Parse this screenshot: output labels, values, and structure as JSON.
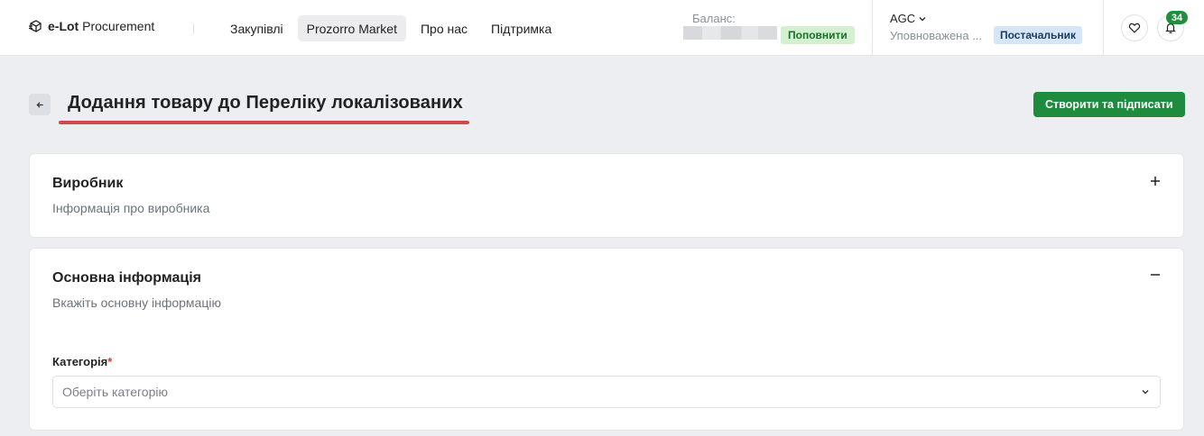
{
  "header": {
    "brand_bold": "e-Lot",
    "brand_rest": "Procurement",
    "nav": [
      {
        "label": "Закупівлі"
      },
      {
        "label": "Prozorro Market"
      },
      {
        "label": "Про нас"
      },
      {
        "label": "Підтримка"
      }
    ],
    "balance_label": "Баланс:",
    "topup_label": "Поповнити",
    "user_name": "AGC",
    "user_role": "Уповноважена ...",
    "user_badge": "Постачальник",
    "notifications_count": "34"
  },
  "page": {
    "title": "Додання товару до Переліку локалізованих",
    "create_button": "Створити та підписати"
  },
  "cards": {
    "manufacturer": {
      "title": "Виробник",
      "subtitle": "Інформація про виробника"
    },
    "basic": {
      "title": "Основна інформація",
      "subtitle": "Вкажіть основну інформацію",
      "category_label": "Категорія",
      "required_mark": "*",
      "category_placeholder": "Оберіть категорію"
    }
  },
  "colors": {
    "primary": "#1e8b3f",
    "title_underline": "#d04848",
    "topup_bg": "#d3f0d1",
    "badge_bg": "#d5e6f8",
    "page_bg": "#eceef1"
  }
}
